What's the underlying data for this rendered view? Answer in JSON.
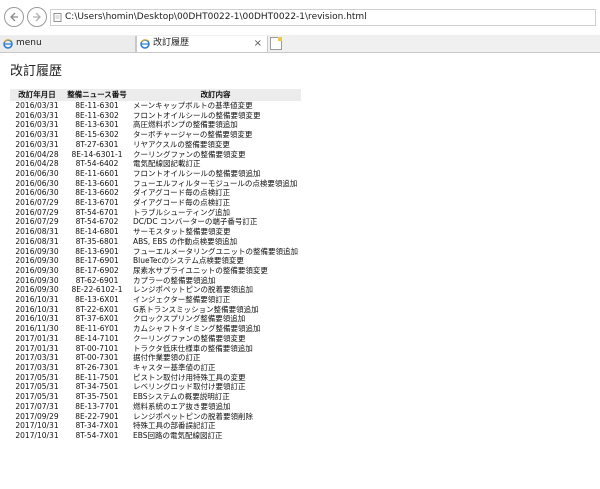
{
  "address_bar": {
    "url": "C:\\Users\\homin\\Desktop\\00DHT0022-1\\00DHT0022-1\\revision.html"
  },
  "tabs": [
    {
      "label": "menu"
    },
    {
      "label": "改訂履歴",
      "close": "×"
    }
  ],
  "page": {
    "title": "改訂履歴",
    "headers": [
      "改訂年月日",
      "整備ニュース番号",
      "改訂内容"
    ],
    "rows": [
      [
        "2016/03/31",
        "8E-11-6301",
        "メーンキャップボルトの基準値変更"
      ],
      [
        "2016/03/31",
        "8E-11-6302",
        "フロントオイルシールの整備要領変更"
      ],
      [
        "2016/03/31",
        "8E-13-6301",
        "高圧燃料ポンプの整備要領追加"
      ],
      [
        "2016/03/31",
        "8E-15-6302",
        "ターボチャージャーの整備要領変更"
      ],
      [
        "2016/03/31",
        "8T-27-6301",
        "リヤアクスルの整備要領変更"
      ],
      [
        "2016/04/28",
        "8E-14-6301-1",
        "クーリングファンの整備要領変更"
      ],
      [
        "2016/04/28",
        "8T-54-6402",
        "電気配線図記載訂正"
      ],
      [
        "2016/06/30",
        "8E-11-6601",
        "フロントオイルシールの整備要領追加"
      ],
      [
        "2016/06/30",
        "8E-13-6601",
        "フューエルフィルターモジュールの点検要領追加"
      ],
      [
        "2016/06/30",
        "8E-13-6602",
        "ダイアグコード毎の点検訂正"
      ],
      [
        "2016/07/29",
        "8E-13-6701",
        "ダイアグコード毎の点検訂正"
      ],
      [
        "2016/07/29",
        "8T-54-6701",
        "トラブルシューティング追加"
      ],
      [
        "2016/07/29",
        "8T-54-6702",
        "DC/DC コンバーターの端子番号訂正"
      ],
      [
        "2016/08/31",
        "8E-14-6801",
        "サーモスタット整備要領変更"
      ],
      [
        "2016/08/31",
        "8T-35-6801",
        "ABS, EBS の作動点検要領追加"
      ],
      [
        "2016/09/30",
        "8E-13-6901",
        "フューエルメータリングユニットの整備要領追加"
      ],
      [
        "2016/09/30",
        "8E-17-6901",
        "BlueTecのシステム点検要領変更"
      ],
      [
        "2016/09/30",
        "8E-17-6902",
        "尿素水サプライユニットの整備要領変更"
      ],
      [
        "2016/09/30",
        "8T-62-6901",
        "カプラーの整備要領追加"
      ],
      [
        "2016/09/30",
        "8E-22-6102-1",
        "レンジポペットピンの脱着要領追加"
      ],
      [
        "2016/10/31",
        "8E-13-6X01",
        "インジェクター整備要領訂正"
      ],
      [
        "2016/10/31",
        "8T-22-6X01",
        "G系トランスミッション整備要領追加"
      ],
      [
        "2016/10/31",
        "8T-37-6X01",
        "クロックスプリング整備要領追加"
      ],
      [
        "2016/11/30",
        "8E-11-6Y01",
        "カムシャフトタイミング整備要領追加"
      ],
      [
        "2017/01/31",
        "8E-14-7101",
        "クーリングファンの整備要領変更"
      ],
      [
        "2017/01/31",
        "8T-00-7101",
        "トラクタ低床仕様車の整備要領追加"
      ],
      [
        "2017/03/31",
        "8T-00-7301",
        "据付作業要領の訂正"
      ],
      [
        "2017/03/31",
        "8T-26-7301",
        "キャスター基準値の訂正"
      ],
      [
        "2017/05/31",
        "8E-11-7501",
        "ピストン取付け用特殊工具の変更"
      ],
      [
        "2017/05/31",
        "8T-34-7501",
        "レベリングロッド取付け要領訂正"
      ],
      [
        "2017/05/31",
        "8T-35-7501",
        "EBSシステムの概要説明訂正"
      ],
      [
        "2017/07/31",
        "8E-13-7701",
        "燃料系統のエア抜き要領追加"
      ],
      [
        "2017/09/29",
        "8E-22-7901",
        "レンジポペットピンの脱着要領削除"
      ],
      [
        "2017/10/31",
        "8T-34-7X01",
        "特殊工具の部番誤記訂正"
      ],
      [
        "2017/10/31",
        "8T-54-7X01",
        "EBS回路の電気配線図訂正"
      ]
    ]
  }
}
